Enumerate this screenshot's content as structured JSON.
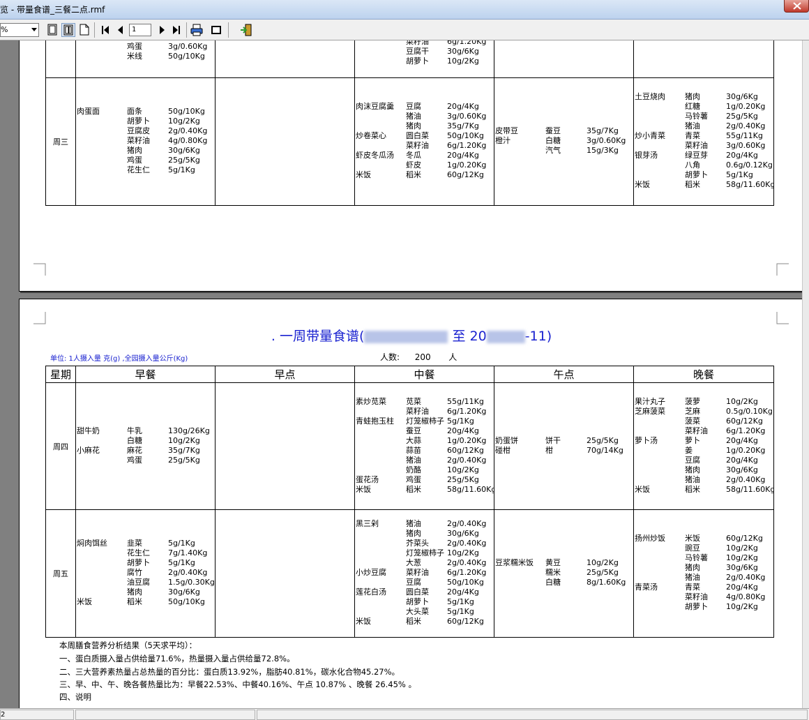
{
  "window": {
    "title": "览 - 带量食谱_三餐二点.rmf",
    "close_label": "×"
  },
  "toolbar": {
    "zoom_value": "%",
    "page_number": "1",
    "buttons": [
      {
        "name": "single-page-view-icon"
      },
      {
        "name": "two-page-view-icon"
      },
      {
        "name": "page-width-view-icon"
      },
      {
        "name": "first-page-icon"
      },
      {
        "name": "prev-page-icon"
      },
      {
        "name": "next-page-icon"
      },
      {
        "name": "last-page-icon"
      },
      {
        "name": "print-icon"
      },
      {
        "name": "stop-icon"
      },
      {
        "name": "exit-icon"
      }
    ]
  },
  "page1": {
    "partial_rows": {
      "breakfast": [
        {
          "c1": "",
          "c2": "鸡蛋",
          "c3": "3g/0.60Kg"
        },
        {
          "c1": "",
          "c2": "米线",
          "c3": "50g/10Kg"
        }
      ],
      "lunch": [
        {
          "c1": "",
          "c2": "菜籽油",
          "c3": "6g/1.20Kg"
        },
        {
          "c1": "",
          "c2": "豆腐干",
          "c3": "30g/6Kg"
        },
        {
          "c1": "",
          "c2": "胡萝卜",
          "c3": "10g/2Kg"
        }
      ],
      "dinner": [
        {
          "c1": "",
          "c2": "",
          "c3": ""
        }
      ]
    },
    "wednesday": {
      "day": "周三",
      "breakfast": [
        {
          "c1": "肉蛋面",
          "c2": "面条",
          "c3": "50g/10Kg"
        },
        {
          "c1": "",
          "c2": "胡萝卜",
          "c3": "10g/2Kg"
        },
        {
          "c1": "",
          "c2": "豆腐皮",
          "c3": "2g/0.40Kg"
        },
        {
          "c1": "",
          "c2": "菜籽油",
          "c3": "4g/0.80Kg"
        },
        {
          "c1": "",
          "c2": "猪肉",
          "c3": "30g/6Kg"
        },
        {
          "c1": "",
          "c2": "鸡蛋",
          "c3": "25g/5Kg"
        },
        {
          "c1": "",
          "c2": "花生仁",
          "c3": "5g/1Kg"
        }
      ],
      "morning_snack": [],
      "lunch": [
        {
          "c1": "肉沫豆腐羹",
          "c2": "豆腐",
          "c3": "20g/4Kg"
        },
        {
          "c1": "",
          "c2": "猪油",
          "c3": "3g/0.60Kg"
        },
        {
          "c1": "",
          "c2": "猪肉",
          "c3": "35g/7Kg"
        },
        {
          "c1": "炒卷菜心",
          "c2": "圆白菜",
          "c3": "50g/10Kg"
        },
        {
          "c1": "",
          "c2": "菜籽油",
          "c3": "6g/1.20Kg"
        },
        {
          "c1": "虾皮冬瓜汤",
          "c2": "冬瓜",
          "c3": "20g/4Kg"
        },
        {
          "c1": "",
          "c2": "虾皮",
          "c3": "1g/0.20Kg"
        },
        {
          "c1": "米饭",
          "c2": "稻米",
          "c3": "60g/12Kg"
        }
      ],
      "afternoon_snack": [
        {
          "c1": "皮带豆",
          "c2": "蚕豆",
          "c3": "35g/7Kg"
        },
        {
          "c1": "橙汁",
          "c2": "白糖",
          "c3": "3g/0.60Kg"
        },
        {
          "c1": "",
          "c2": "汽气",
          "c3": "15g/3Kg"
        }
      ],
      "dinner": [
        {
          "c1": "土豆烧肉",
          "c2": "猪肉",
          "c3": "30g/6Kg"
        },
        {
          "c1": "",
          "c2": "红糖",
          "c3": "1g/0.20Kg"
        },
        {
          "c1": "",
          "c2": "马铃薯",
          "c3": "25g/5Kg"
        },
        {
          "c1": "",
          "c2": "猪油",
          "c3": "2g/0.40Kg"
        },
        {
          "c1": "炒小青菜",
          "c2": "青菜",
          "c3": "55g/11Kg"
        },
        {
          "c1": "",
          "c2": "菜籽油",
          "c3": "3g/0.60Kg"
        },
        {
          "c1": "银芽汤",
          "c2": "绿豆芽",
          "c3": "20g/4Kg"
        },
        {
          "c1": "",
          "c2": "八角",
          "c3": "0.6g/0.12Kg"
        },
        {
          "c1": "",
          "c2": "胡萝卜",
          "c3": "5g/1Kg"
        },
        {
          "c1": "米饭",
          "c2": "稻米",
          "c3": "58g/11.60Kg"
        }
      ]
    }
  },
  "page2": {
    "title_prefix": ". 一周带量食谱(",
    "title_middle": "至 20",
    "title_suffix": "-11)",
    "unit_line": "单位: 1人摄入量 克(g)   ,全园摄入量公斤(Kg)",
    "people_label": "人数:",
    "people_count": "200",
    "people_unit": "人",
    "headers": [
      "星期",
      "早餐",
      "早点",
      "中餐",
      "午点",
      "晚餐"
    ],
    "thursday": {
      "day": "周四",
      "breakfast": [
        {
          "c1": "甜牛奶",
          "c2": "牛乳",
          "c3": "130g/26Kg"
        },
        {
          "c1": "",
          "c2": "白糖",
          "c3": "10g/2Kg"
        },
        {
          "c1": "小麻花",
          "c2": "麻花",
          "c3": "35g/7Kg"
        },
        {
          "c1": "",
          "c2": "鸡蛋",
          "c3": "25g/5Kg"
        }
      ],
      "morning_snack": [],
      "lunch": [
        {
          "c1": "素炒苋菜",
          "c2": "苋菜",
          "c3": "55g/11Kg"
        },
        {
          "c1": "",
          "c2": "菜籽油",
          "c3": "6g/1.20Kg"
        },
        {
          "c1": "青蛙抱玉柱",
          "c2": "灯笼椒柿子",
          "c3": "5g/1Kg"
        },
        {
          "c1": "",
          "c2": "蚕豆",
          "c3": "20g/4Kg"
        },
        {
          "c1": "",
          "c2": "大蒜",
          "c3": "1g/0.20Kg"
        },
        {
          "c1": "",
          "c2": "蒜苗",
          "c3": "60g/12Kg"
        },
        {
          "c1": "",
          "c2": "猪油",
          "c3": "2g/0.40Kg"
        },
        {
          "c1": "",
          "c2": "奶酪",
          "c3": "10g/2Kg"
        },
        {
          "c1": "蛋花汤",
          "c2": "鸡蛋",
          "c3": "25g/5Kg"
        },
        {
          "c1": "米饭",
          "c2": "稻米",
          "c3": "58g/11.60Kg"
        }
      ],
      "afternoon_snack": [
        {
          "c1": "奶蛋饼",
          "c2": "饼干",
          "c3": "25g/5Kg"
        },
        {
          "c1": "碰柑",
          "c2": "柑",
          "c3": "70g/14Kg"
        }
      ],
      "dinner": [
        {
          "c1": "果汁丸子",
          "c2": "菠萝",
          "c3": "10g/2Kg"
        },
        {
          "c1": "芝麻菠菜",
          "c2": "芝麻",
          "c3": "0.5g/0.10Kg"
        },
        {
          "c1": "",
          "c2": "菠菜",
          "c3": "60g/12Kg"
        },
        {
          "c1": "",
          "c2": "菜籽油",
          "c3": "6g/1.20Kg"
        },
        {
          "c1": "萝卜汤",
          "c2": "萝卜",
          "c3": "20g/4Kg"
        },
        {
          "c1": "",
          "c2": "姜",
          "c3": "1g/0.20Kg"
        },
        {
          "c1": "",
          "c2": "豆腐",
          "c3": "20g/4Kg"
        },
        {
          "c1": "",
          "c2": "猪肉",
          "c3": "30g/6Kg"
        },
        {
          "c1": "",
          "c2": "猪油",
          "c3": "2g/0.40Kg"
        },
        {
          "c1": "米饭",
          "c2": "稻米",
          "c3": "58g/11.60Kg"
        }
      ]
    },
    "friday": {
      "day": "周五",
      "breakfast": [
        {
          "c1": "焖肉饵丝",
          "c2": "韭菜",
          "c3": "5g/1Kg"
        },
        {
          "c1": "",
          "c2": "花生仁",
          "c3": "7g/1.40Kg"
        },
        {
          "c1": "",
          "c2": "胡萝卜",
          "c3": "5g/1Kg"
        },
        {
          "c1": "",
          "c2": "腐竹",
          "c3": "2g/0.40Kg"
        },
        {
          "c1": "",
          "c2": "油豆腐",
          "c3": "1.5g/0.30Kg"
        },
        {
          "c1": "",
          "c2": "猪肉",
          "c3": "30g/6Kg"
        },
        {
          "c1": "米饭",
          "c2": "稻米",
          "c3": "50g/10Kg"
        }
      ],
      "morning_snack": [],
      "lunch": [
        {
          "c1": "黑三剁",
          "c2": "猪油",
          "c3": "2g/0.40Kg"
        },
        {
          "c1": "",
          "c2": "猪肉",
          "c3": "30g/6Kg"
        },
        {
          "c1": "",
          "c2": "芥菜头",
          "c3": "2g/0.40Kg"
        },
        {
          "c1": "",
          "c2": "灯笼椒柿子",
          "c3": "10g/2Kg"
        },
        {
          "c1": "",
          "c2": "大葱",
          "c3": "2g/0.40Kg"
        },
        {
          "c1": "小炒豆腐",
          "c2": "菜籽油",
          "c3": "6g/1.20Kg"
        },
        {
          "c1": "",
          "c2": "豆腐",
          "c3": "50g/10Kg"
        },
        {
          "c1": "莲花白汤",
          "c2": "圆白菜",
          "c3": "20g/4Kg"
        },
        {
          "c1": "",
          "c2": "胡萝卜",
          "c3": "5g/1Kg"
        },
        {
          "c1": "",
          "c2": "大头菜",
          "c3": "5g/1Kg"
        },
        {
          "c1": "米饭",
          "c2": "稻米",
          "c3": "60g/12Kg"
        }
      ],
      "afternoon_snack": [
        {
          "c1": "豆浆糯米饭",
          "c2": "黄豆",
          "c3": "10g/2Kg"
        },
        {
          "c1": "",
          "c2": "糯米",
          "c3": "25g/5Kg"
        },
        {
          "c1": "",
          "c2": "白糖",
          "c3": "8g/1.60Kg"
        }
      ],
      "dinner": [
        {
          "c1": "扬州炒饭",
          "c2": "米饭",
          "c3": "60g/12Kg"
        },
        {
          "c1": "",
          "c2": "豌豆",
          "c3": "10g/2Kg"
        },
        {
          "c1": "",
          "c2": "马铃薯",
          "c3": "10g/2Kg"
        },
        {
          "c1": "",
          "c2": "猪肉",
          "c3": "30g/6Kg"
        },
        {
          "c1": "",
          "c2": "猪油",
          "c3": "2g/0.40Kg"
        },
        {
          "c1": "青菜汤",
          "c2": "青菜",
          "c3": "20g/4Kg"
        },
        {
          "c1": "",
          "c2": "菜籽油",
          "c3": "4g/0.80Kg"
        },
        {
          "c1": "",
          "c2": "胡萝卜",
          "c3": "10g/2Kg"
        }
      ]
    },
    "summary": [
      "本周膳食营养分析结果（5天求平均）：",
      "一、蛋白质摄入量占供给量71.6%，热量摄入量占供给量72.8%。",
      "二、三大营养素热量占总热量的百分比：蛋白质13.92%，脂肪40.81%，碳水化合物45.27%。",
      "三、早、中、午、晚各餐热量比为：早餐22.53%、中餐40.16%、午点 10.87% 、晚餐 26.45% 。",
      "四、说明"
    ]
  },
  "statusbar": {
    "page_indicator": "2"
  },
  "colors": {
    "title_blue": "#1a22d0",
    "titlebar": "#bcd2ee",
    "background": "#808080"
  }
}
